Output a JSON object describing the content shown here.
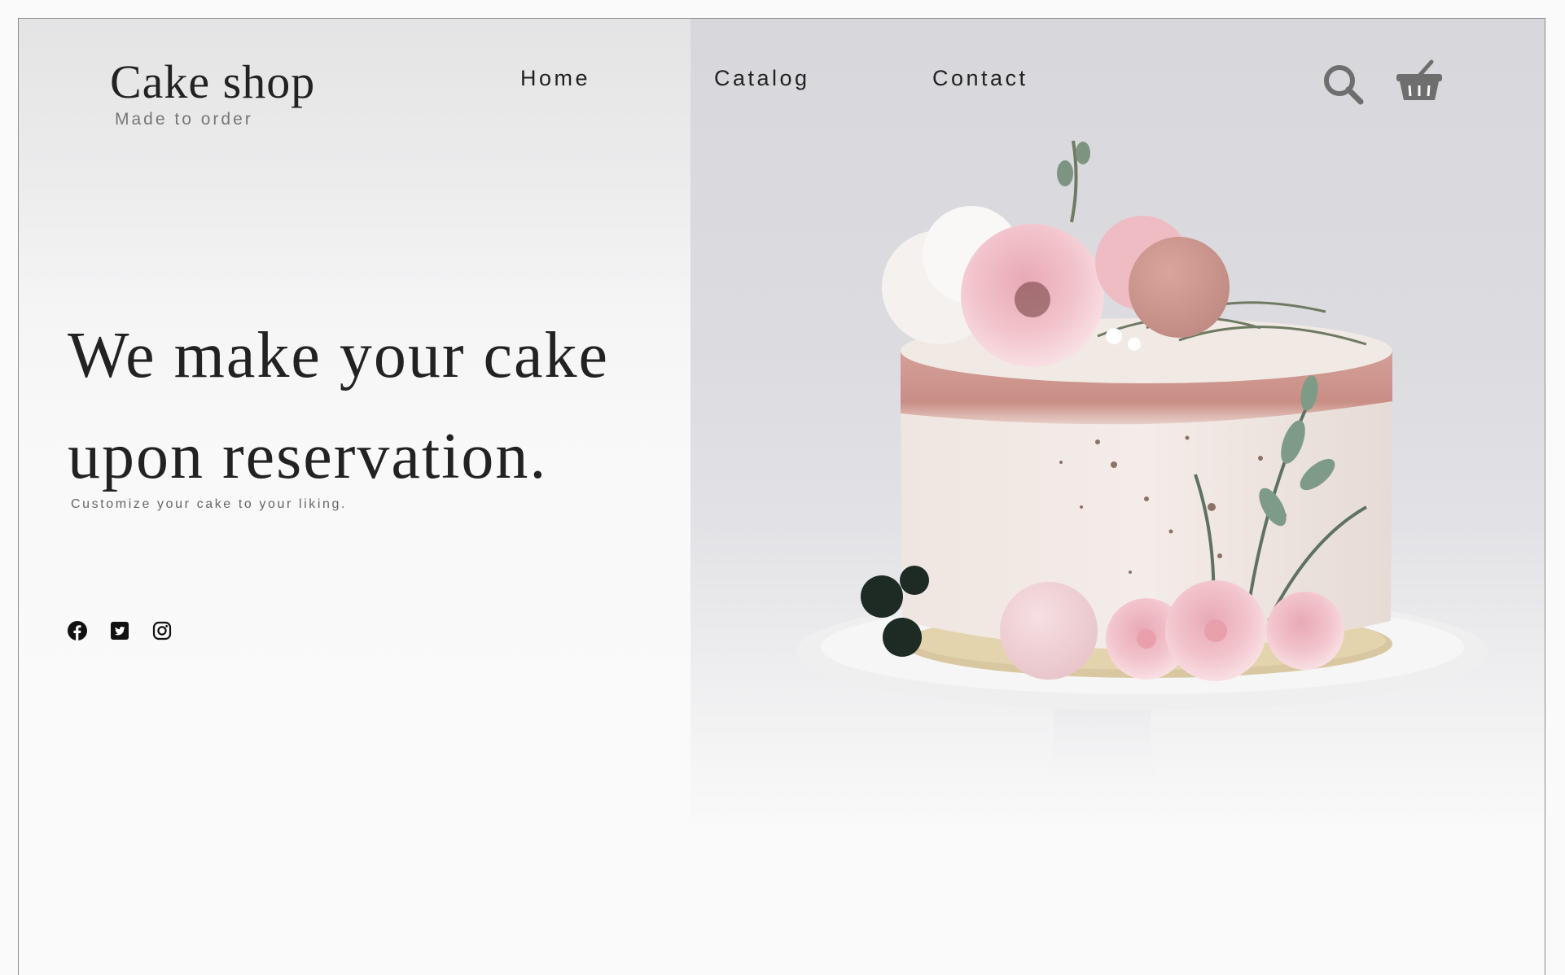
{
  "brand": {
    "name": "Cake shop",
    "tagline": "Made to order"
  },
  "nav": {
    "items": [
      {
        "label": "Home"
      },
      {
        "label": "Catalog"
      },
      {
        "label": "Contact"
      }
    ]
  },
  "header_icons": {
    "search": "search-icon",
    "cart": "basket-icon"
  },
  "hero": {
    "title_line1": "We make your cake",
    "title_line2": "upon reservation.",
    "subtitle": "Customize your cake to your liking.",
    "image": "cake-photo"
  },
  "social": {
    "icons": [
      "facebook-icon",
      "twitter-icon",
      "instagram-icon"
    ]
  },
  "colors": {
    "text": "#222222",
    "muted": "#777777",
    "accent_pink": "#c98e86",
    "icon_gray": "#6e6e6e"
  }
}
